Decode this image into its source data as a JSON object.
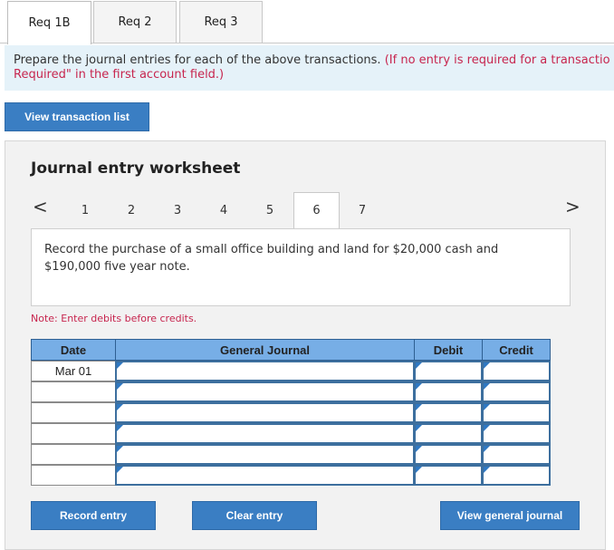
{
  "tabs": [
    {
      "label": "Req 1B"
    },
    {
      "label": "Req 2"
    },
    {
      "label": "Req 3"
    }
  ],
  "instruction": {
    "main": "Prepare the journal entries for each of the above transactions.",
    "red_part1": "(If no entry is required for a transactio",
    "red_part2": "Required\" in the first account field.)"
  },
  "view_transaction_list": "View transaction list",
  "worksheet": {
    "title": "Journal entry worksheet",
    "prev_arrow": "<",
    "next_arrow": ">",
    "pages": [
      "1",
      "2",
      "3",
      "4",
      "5",
      "6",
      "7"
    ],
    "active_page": "6",
    "description_line1": "Record the purchase of a small office building and land for $20,000 cash and",
    "description_line2": "$190,000 five year note.",
    "note": "Note: Enter debits before credits."
  },
  "table": {
    "headers": {
      "date": "Date",
      "journal": "General Journal",
      "debit": "Debit",
      "credit": "Credit"
    },
    "rows": [
      {
        "date": "Mar 01",
        "account": "",
        "debit": "",
        "credit": ""
      },
      {
        "date": "",
        "account": "",
        "debit": "",
        "credit": ""
      },
      {
        "date": "",
        "account": "",
        "debit": "",
        "credit": ""
      },
      {
        "date": "",
        "account": "",
        "debit": "",
        "credit": ""
      },
      {
        "date": "",
        "account": "",
        "debit": "",
        "credit": ""
      },
      {
        "date": "",
        "account": "",
        "debit": "",
        "credit": ""
      }
    ]
  },
  "buttons": {
    "record": "Record entry",
    "clear": "Clear entry",
    "view_journal": "View general journal"
  },
  "colors": {
    "button": "#3a7ec3",
    "header": "#77aee6",
    "instruction_bg": "#e5f2f9",
    "red_text": "#c7254e"
  }
}
